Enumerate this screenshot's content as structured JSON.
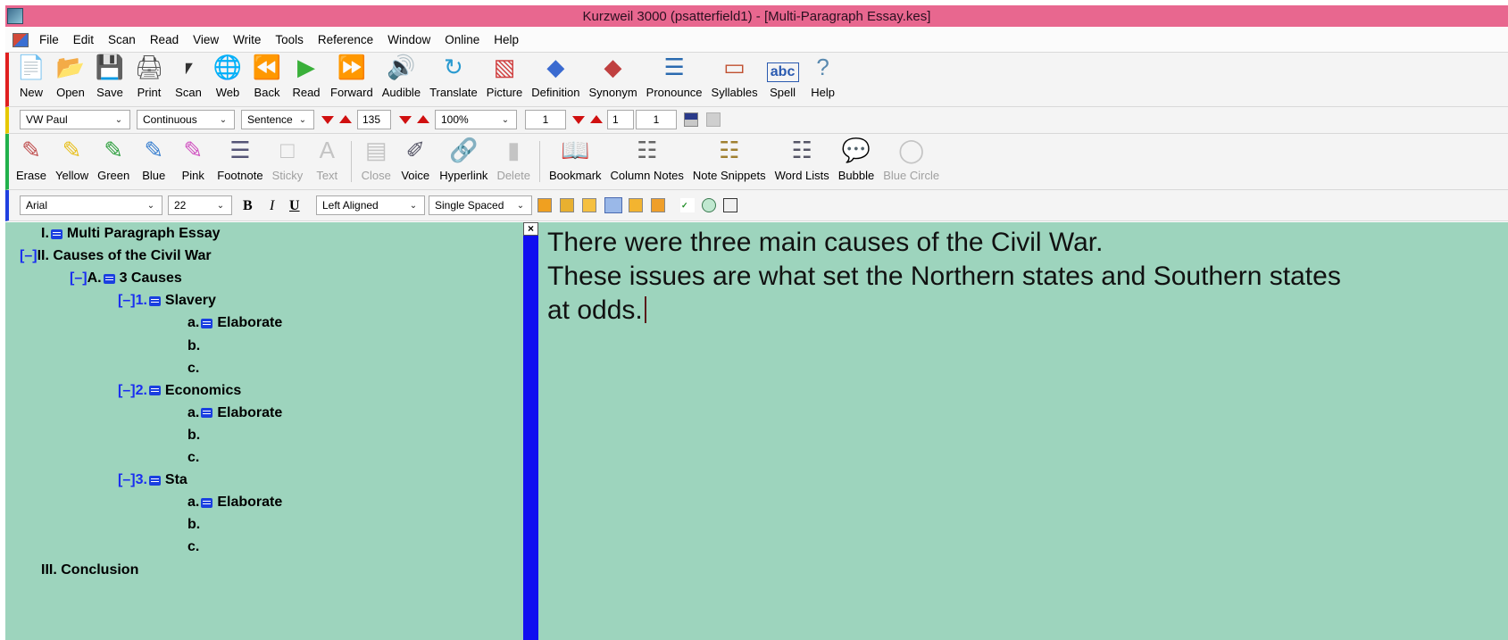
{
  "window": {
    "title": "Kurzweil 3000 (psatterfield1) - [Multi-Paragraph Essay.kes]"
  },
  "menu": [
    "File",
    "Edit",
    "Scan",
    "Read",
    "View",
    "Write",
    "Tools",
    "Reference",
    "Window",
    "Online",
    "Help"
  ],
  "toolbar_main": [
    {
      "label": "New",
      "icon": "new-document-icon"
    },
    {
      "label": "Open",
      "icon": "open-folder-icon"
    },
    {
      "label": "Save",
      "icon": "save-disk-icon"
    },
    {
      "label": "Print",
      "icon": "printer-icon"
    },
    {
      "label": "Scan",
      "icon": "scanner-icon"
    },
    {
      "label": "Web",
      "icon": "globe-icon"
    },
    {
      "label": "Back",
      "icon": "back-arrows-icon"
    },
    {
      "label": "Read",
      "icon": "play-icon"
    },
    {
      "label": "Forward",
      "icon": "forward-arrows-icon"
    },
    {
      "label": "Audible",
      "icon": "speaker-icon"
    },
    {
      "label": "Translate",
      "icon": "translate-icon"
    },
    {
      "label": "Picture",
      "icon": "picture-icon"
    },
    {
      "label": "Definition",
      "icon": "definition-book-icon"
    },
    {
      "label": "Synonym",
      "icon": "synonym-book-icon"
    },
    {
      "label": "Pronounce",
      "icon": "pronounce-head-icon"
    },
    {
      "label": "Syllables",
      "icon": "syllables-icon"
    },
    {
      "label": "Spell",
      "icon": "spell-abc-icon"
    },
    {
      "label": "Help",
      "icon": "help-question-icon"
    }
  ],
  "reading_controls": {
    "voice": "VW Paul",
    "mode": "Continuous",
    "unit": "Sentence",
    "speed": "135",
    "zoom": "100%",
    "page_current": "1",
    "page_input": "1",
    "page_total": "1"
  },
  "toolbar_study": [
    {
      "label": "Erase",
      "icon": "eraser-icon",
      "enabled": true
    },
    {
      "label": "Yellow",
      "icon": "yellow-highlighter-icon",
      "enabled": true
    },
    {
      "label": "Green",
      "icon": "green-highlighter-icon",
      "enabled": true
    },
    {
      "label": "Blue",
      "icon": "blue-highlighter-icon",
      "enabled": true
    },
    {
      "label": "Pink",
      "icon": "pink-highlighter-icon",
      "enabled": true
    },
    {
      "label": "Footnote",
      "icon": "footnote-icon",
      "enabled": true
    },
    {
      "label": "Sticky",
      "icon": "sticky-note-icon",
      "enabled": false
    },
    {
      "label": "Text",
      "icon": "text-a-icon",
      "enabled": false
    },
    {
      "label": "Close",
      "icon": "close-note-icon",
      "enabled": false
    },
    {
      "label": "Voice",
      "icon": "microphone-icon",
      "enabled": true
    },
    {
      "label": "Hyperlink",
      "icon": "chain-link-icon",
      "enabled": true
    },
    {
      "label": "Delete",
      "icon": "trash-icon",
      "enabled": false
    },
    {
      "label": "Bookmark",
      "icon": "bookmark-book-icon",
      "enabled": true
    },
    {
      "label": "Column Notes",
      "icon": "column-notes-icon",
      "enabled": true
    },
    {
      "label": "Note Snippets",
      "icon": "note-snippets-icon",
      "enabled": true
    },
    {
      "label": "Word Lists",
      "icon": "word-lists-icon",
      "enabled": true
    },
    {
      "label": "Bubble",
      "icon": "speech-bubble-icon",
      "enabled": true
    },
    {
      "label": "Blue Circle",
      "icon": "blue-circle-icon",
      "enabled": false
    }
  ],
  "format_controls": {
    "font": "Arial",
    "size": "22",
    "bold": "B",
    "italic": "I",
    "underline": "U",
    "alignment": "Left Aligned",
    "spacing": "Single Spaced"
  },
  "outline": [
    {
      "toggle": "",
      "num": "I.",
      "icon": true,
      "text": "Multi Paragraph Essay",
      "blue": false
    },
    {
      "toggle": "[–]",
      "num": "II.",
      "icon": false,
      "text": "Causes of the Civil War",
      "blue": false
    },
    {
      "toggle": "[–]",
      "num": "A.",
      "icon": true,
      "text": "3 Causes",
      "blue": false
    },
    {
      "toggle": "[–]",
      "num": "1.",
      "icon": true,
      "text": "Slavery",
      "blue": true
    },
    {
      "toggle": "",
      "num": "a.",
      "icon": true,
      "text": "Elaborate",
      "blue": false
    },
    {
      "toggle": "",
      "num": "b.",
      "icon": false,
      "text": "",
      "blue": false
    },
    {
      "toggle": "",
      "num": "c.",
      "icon": false,
      "text": "",
      "blue": false
    },
    {
      "toggle": "[–]",
      "num": "2.",
      "icon": true,
      "text": "Economics",
      "blue": true
    },
    {
      "toggle": "",
      "num": "a.",
      "icon": true,
      "text": "Elaborate",
      "blue": false
    },
    {
      "toggle": "",
      "num": "b.",
      "icon": false,
      "text": "",
      "blue": false
    },
    {
      "toggle": "",
      "num": "c.",
      "icon": false,
      "text": "",
      "blue": false
    },
    {
      "toggle": "[–]",
      "num": "3.",
      "icon": true,
      "text": "Sta",
      "blue": true
    },
    {
      "toggle": "",
      "num": "a.",
      "icon": true,
      "text": "Elaborate",
      "blue": false
    },
    {
      "toggle": "",
      "num": "b.",
      "icon": false,
      "text": "",
      "blue": false
    },
    {
      "toggle": "",
      "num": "c.",
      "icon": false,
      "text": "",
      "blue": false
    },
    {
      "toggle": "",
      "num": "III.",
      "icon": false,
      "text": "Conclusion",
      "blue": false
    }
  ],
  "editor": {
    "lines": [
      "There were three main causes of the Civil War.",
      "These issues are what set the Northern states and Southern states",
      "at odds."
    ]
  },
  "colors": {
    "titlebar": "#e8678f",
    "pane_background": "#9dd4bd",
    "divider": "#1010f0",
    "outline_blue": "#1a2ef0"
  }
}
